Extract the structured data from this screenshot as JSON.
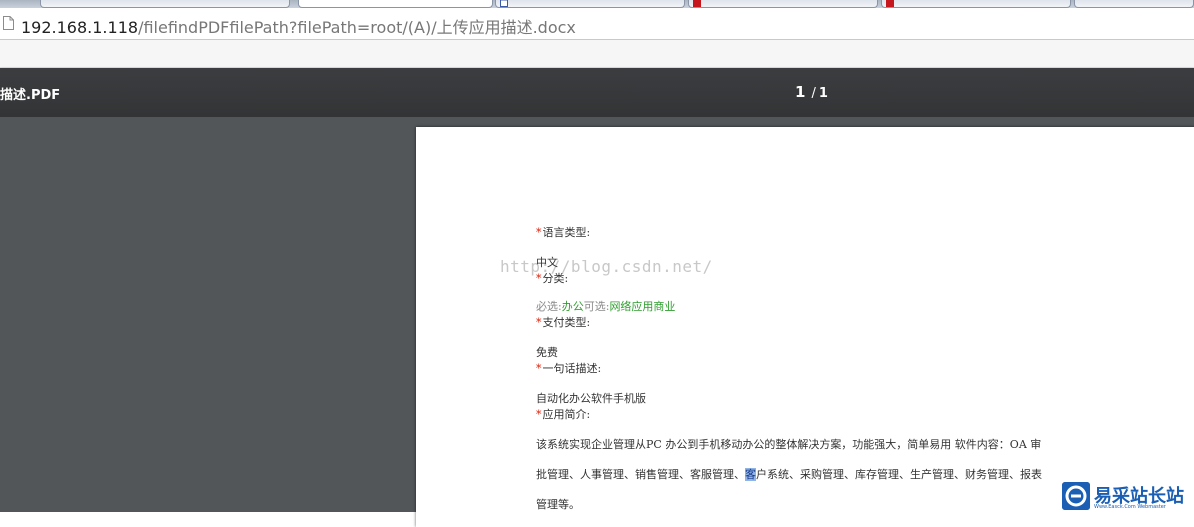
{
  "browser": {
    "address_bar": {
      "url_host": "192.168.1.118",
      "url_path": "/filefindPDFfilePath?filePath=root/(A)/上传应用描述.docx"
    }
  },
  "viewer": {
    "title": "描述.PDF",
    "page_current": "1",
    "page_separator": "/",
    "page_total": "1",
    "background_color": "#525659",
    "toolbar_color": "#323436"
  },
  "document": {
    "watermark": "http://blog.csdn.net/",
    "required_marker": "*",
    "language_label": "语言类型:",
    "language_value": "中文",
    "category_label": "分类:",
    "category_required_prefix": "必选:",
    "category_required_value": "办公",
    "category_optional_prefix": "可选:",
    "category_optional_value": "网络应用商业",
    "payment_label": "支付类型:",
    "payment_value": "免费",
    "tagline_label": "一句话描述:",
    "tagline_value": "自动化办公软件手机版",
    "intro_label": "应用简介:",
    "intro_line1": "该系统实现企业管理从PC 办公到手机移动办公的整体解决方案，功能强大，简单易用  软件内容：OA 审",
    "intro_line2_before": "批管理、人事管理、销售管理、客服管理、",
    "intro_line2_selected": "客",
    "intro_line2_after": "户系统、采购管理、库存管理、生产管理、财务管理、报表",
    "intro_line3": "管理等。",
    "accent_red": "#d81e06",
    "accent_green": "#2e9e2e"
  },
  "site_logo": {
    "text": "易采站长站",
    "subtext": "Www.Easck.Com Webmaster"
  }
}
